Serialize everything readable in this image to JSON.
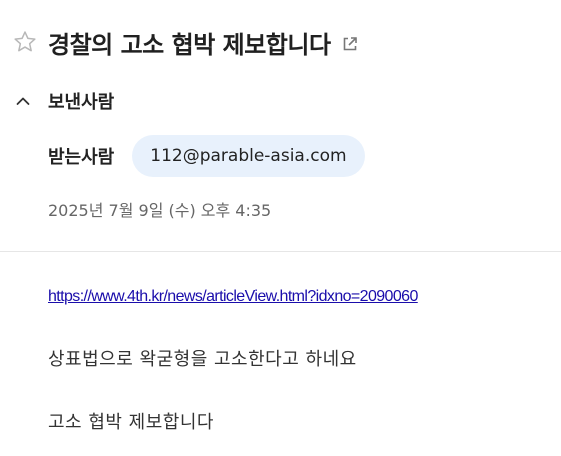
{
  "message": {
    "subject": "경찰의 고소 협박 제보합니다",
    "starred": false,
    "sender_label": "보낸사람",
    "recipient_label": "받는사람",
    "recipient_email": "112@parable-asia.com",
    "date": "2025년 7월 9일 (수) 오후 4:35"
  },
  "body": {
    "link": "https://www.4th.kr/news/articleView.html?idxno=2090060",
    "lines": [
      "상표법으로 왁굳형을 고소한다고 하네요",
      "고소 협박 제보합니다"
    ]
  },
  "icons": {
    "star": "star-outline-icon",
    "popout": "open-in-new-window-icon",
    "collapse": "chevron-up-icon"
  },
  "colors": {
    "chip_background": "#e8f1fc",
    "link": "#1a0dab",
    "star_outline": "#b8b8b8"
  }
}
